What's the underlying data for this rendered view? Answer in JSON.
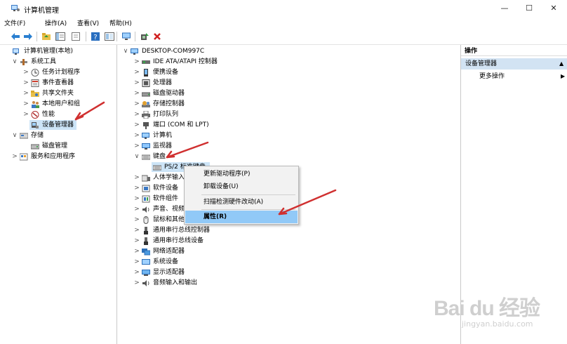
{
  "window": {
    "title": "计算机管理",
    "minimize": "—",
    "maximize": "☐",
    "close": "✕"
  },
  "menu": [
    "文件(F)",
    "操作(A)",
    "查看(V)",
    "帮助(H)"
  ],
  "toolbar_icons": [
    "back-arrow-icon",
    "forward-arrow-icon",
    "up-folder-icon",
    "show-hide-tree-icon",
    "properties-icon",
    "help-icon",
    "view-icon",
    "monitor-icon",
    "update-driver-icon",
    "remove-device-icon"
  ],
  "left_tree": [
    {
      "label": "计算机管理(本地)",
      "level": 0,
      "chev": "",
      "icon": "computer-mgmt-icon"
    },
    {
      "label": "系统工具",
      "level": 1,
      "chev": "∨",
      "icon": "tools-icon"
    },
    {
      "label": "任务计划程序",
      "level": 2,
      "chev": ">",
      "icon": "clock-icon"
    },
    {
      "label": "事件查看器",
      "level": 2,
      "chev": ">",
      "icon": "event-viewer-icon"
    },
    {
      "label": "共享文件夹",
      "level": 2,
      "chev": ">",
      "icon": "shared-folder-icon"
    },
    {
      "label": "本地用户和组",
      "level": 2,
      "chev": ">",
      "icon": "users-icon"
    },
    {
      "label": "性能",
      "level": 2,
      "chev": ">",
      "icon": "performance-icon"
    },
    {
      "label": "设备管理器",
      "level": 2,
      "chev": "",
      "icon": "device-manager-icon",
      "selected": true
    },
    {
      "label": "存储",
      "level": 1,
      "chev": "∨",
      "icon": "storage-icon"
    },
    {
      "label": "磁盘管理",
      "level": 2,
      "chev": "",
      "icon": "disk-mgmt-icon"
    },
    {
      "label": "服务和应用程序",
      "level": 1,
      "chev": ">",
      "icon": "services-icon"
    }
  ],
  "device_tree": {
    "root": "DESKTOP-COM997C",
    "items": [
      {
        "label": "IDE ATA/ATAPI 控制器",
        "chev": ">",
        "icon": "ide-icon"
      },
      {
        "label": "便携设备",
        "chev": ">",
        "icon": "portable-icon"
      },
      {
        "label": "处理器",
        "chev": ">",
        "icon": "cpu-icon"
      },
      {
        "label": "磁盘驱动器",
        "chev": ">",
        "icon": "disk-icon"
      },
      {
        "label": "存储控制器",
        "chev": ">",
        "icon": "storage-ctrl-icon"
      },
      {
        "label": "打印队列",
        "chev": ">",
        "icon": "printer-icon"
      },
      {
        "label": "端口 (COM 和 LPT)",
        "chev": ">",
        "icon": "port-icon"
      },
      {
        "label": "计算机",
        "chev": ">",
        "icon": "computer-icon"
      },
      {
        "label": "监视器",
        "chev": ">",
        "icon": "monitor-icon"
      },
      {
        "label": "键盘",
        "chev": "∨",
        "icon": "keyboard-icon"
      },
      {
        "label": "PS/2 标准键盘",
        "chev": "",
        "icon": "keyboard-icon",
        "child": true,
        "selected": true
      },
      {
        "label": "人体学输入设备",
        "chev": ">",
        "icon": "hid-icon"
      },
      {
        "label": "软件设备",
        "chev": ">",
        "icon": "software-device-icon"
      },
      {
        "label": "软件组件",
        "chev": ">",
        "icon": "software-component-icon"
      },
      {
        "label": "声音、视频和游戏控制器",
        "chev": ">",
        "icon": "sound-icon"
      },
      {
        "label": "鼠标和其他指针设备",
        "chev": ">",
        "icon": "mouse-icon"
      },
      {
        "label": "通用串行总线控制器",
        "chev": ">",
        "icon": "usb-icon"
      },
      {
        "label": "通用串行总线设备",
        "chev": ">",
        "icon": "usb-icon"
      },
      {
        "label": "网络适配器",
        "chev": ">",
        "icon": "network-icon"
      },
      {
        "label": "系统设备",
        "chev": ">",
        "icon": "system-icon"
      },
      {
        "label": "显示适配器",
        "chev": ">",
        "icon": "display-icon"
      },
      {
        "label": "音频输入和输出",
        "chev": ">",
        "icon": "audio-icon"
      }
    ]
  },
  "context_menu": [
    {
      "label": "更新驱动程序(P)"
    },
    {
      "label": "卸载设备(U)"
    },
    {
      "label": "扫描检测硬件改动(A)"
    },
    {
      "label": "属性(R)",
      "highlight": true
    }
  ],
  "actions_pane": {
    "header": "操作",
    "section": "设备管理器",
    "more": "更多操作"
  },
  "watermark": {
    "main": "Bai du 经验",
    "sub": "jingyan.baidu.com"
  }
}
